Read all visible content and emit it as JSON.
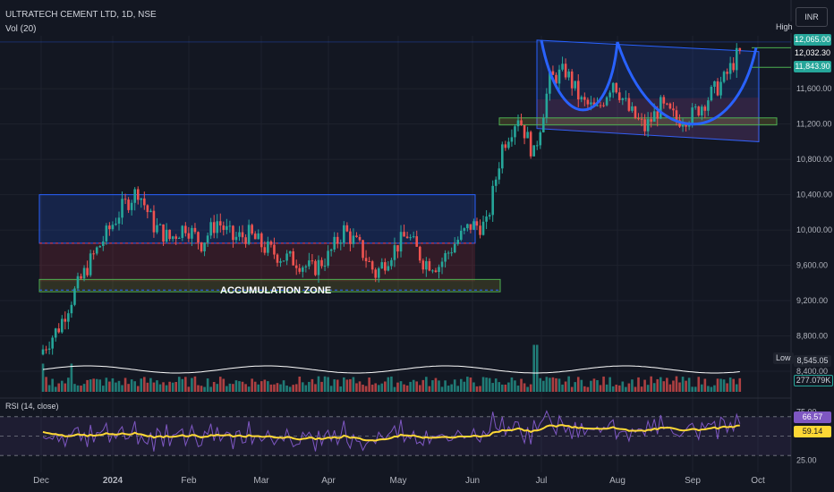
{
  "header": {
    "title": "ULTRATECH CEMENT LTD, 1D, NSE",
    "volume_label": "Vol (20)",
    "rsi_label": "RSI (14, close)"
  },
  "currency": "INR",
  "annotations": {
    "zone_label": "ACCUMULATION ZONE",
    "high_label": "High",
    "low_label": "Low"
  },
  "price_tags": [
    {
      "value": "12,065.00",
      "color": "#26a69a"
    },
    {
      "value": "12,032.30",
      "color": "#131722"
    },
    {
      "value": "11,843.90",
      "color": "#26a69a"
    }
  ],
  "low_value": "8,545.05",
  "volume_value": "277.079K",
  "rsi_values": [
    {
      "value": "66.57",
      "color": "#7e57c2"
    },
    {
      "value": "59.14",
      "color": "#fdd835"
    }
  ],
  "chart_data": {
    "type": "candlestick",
    "symbol": "ULTRATECH CEMENT LTD",
    "interval": "1D",
    "exchange": "NSE",
    "price_axis": {
      "ticks": [
        "11,600.00",
        "11,200.00",
        "10,800.00",
        "10,400.00",
        "10,000.00",
        "9,600.00",
        "9,200.00",
        "8,800.00",
        "8,400.00"
      ],
      "ylim": [
        8400,
        12200
      ]
    },
    "time_axis": {
      "ticks": [
        "Dec",
        "2024",
        "Feb",
        "Mar",
        "Apr",
        "May",
        "Jun",
        "Jul",
        "Aug",
        "Sep",
        "Oct"
      ]
    },
    "close_series": [
      {
        "date": "2023-11-20",
        "close": 8650
      },
      {
        "date": "2023-11-27",
        "close": 8900
      },
      {
        "date": "2023-12-04",
        "close": 9300
      },
      {
        "date": "2023-12-11",
        "close": 9650
      },
      {
        "date": "2023-12-18",
        "close": 9950
      },
      {
        "date": "2023-12-25",
        "close": 10250
      },
      {
        "date": "2024-01-01",
        "close": 10450
      },
      {
        "date": "2024-01-08",
        "close": 10050
      },
      {
        "date": "2024-01-15",
        "close": 9900
      },
      {
        "date": "2024-01-22",
        "close": 10050
      },
      {
        "date": "2024-01-29",
        "close": 9850
      },
      {
        "date": "2024-02-05",
        "close": 10100
      },
      {
        "date": "2024-02-12",
        "close": 9900
      },
      {
        "date": "2024-02-19",
        "close": 9950
      },
      {
        "date": "2024-02-26",
        "close": 9800
      },
      {
        "date": "2024-03-04",
        "close": 9700
      },
      {
        "date": "2024-03-11",
        "close": 9650
      },
      {
        "date": "2024-03-18",
        "close": 9550
      },
      {
        "date": "2024-03-25",
        "close": 9700
      },
      {
        "date": "2024-04-01",
        "close": 10000
      },
      {
        "date": "2024-04-08",
        "close": 9800
      },
      {
        "date": "2024-04-15",
        "close": 9500
      },
      {
        "date": "2024-04-22",
        "close": 9750
      },
      {
        "date": "2024-04-29",
        "close": 9950
      },
      {
        "date": "2024-05-06",
        "close": 9650
      },
      {
        "date": "2024-05-13",
        "close": 9600
      },
      {
        "date": "2024-05-20",
        "close": 9850
      },
      {
        "date": "2024-05-27",
        "close": 10050
      },
      {
        "date": "2024-06-03",
        "close": 10050
      },
      {
        "date": "2024-06-10",
        "close": 10950
      },
      {
        "date": "2024-06-17",
        "close": 11300
      },
      {
        "date": "2024-06-24",
        "close": 10850
      },
      {
        "date": "2024-07-01",
        "close": 11700
      },
      {
        "date": "2024-07-08",
        "close": 11800
      },
      {
        "date": "2024-07-15",
        "close": 11450
      },
      {
        "date": "2024-07-22",
        "close": 11350
      },
      {
        "date": "2024-07-29",
        "close": 11700
      },
      {
        "date": "2024-08-05",
        "close": 11350
      },
      {
        "date": "2024-08-12",
        "close": 11150
      },
      {
        "date": "2024-08-19",
        "close": 11400
      },
      {
        "date": "2024-08-26",
        "close": 11250
      },
      {
        "date": "2024-09-02",
        "close": 11300
      },
      {
        "date": "2024-09-09",
        "close": 11500
      },
      {
        "date": "2024-09-16",
        "close": 11700
      },
      {
        "date": "2024-09-23",
        "close": 12032
      }
    ],
    "high": 12065,
    "low": 8545.05,
    "volume_last": "277.079K",
    "rsi": {
      "rsi_last": 66.57,
      "ma_last": 59.14,
      "levels": [
        70,
        50,
        30
      ],
      "ticks": [
        "75.00",
        "25.00"
      ]
    },
    "zones": [
      {
        "label": "ACCUMULATION ZONE",
        "from": "2023-12",
        "to": "2024-06",
        "low": 9300,
        "high": 9440
      }
    ]
  }
}
